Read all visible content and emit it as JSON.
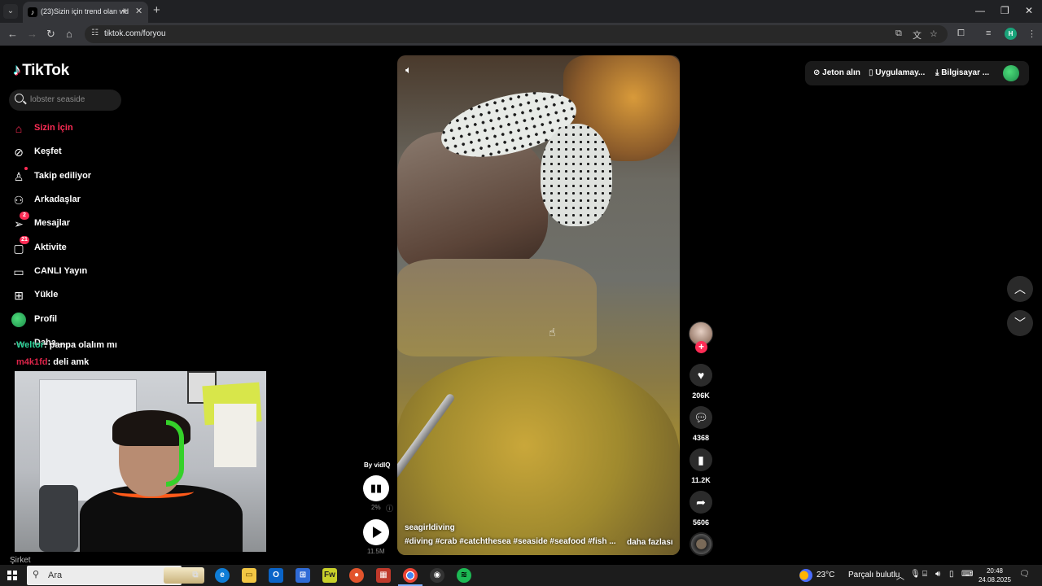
{
  "browser": {
    "tab_title": "(23)Sizin için trend olan vid",
    "url": "tiktok.com/foryou",
    "profile_initial": "H"
  },
  "tiktok": {
    "logo": "TikTok",
    "search_placeholder": "lobster seaside",
    "nav": [
      {
        "label": "Sizin İçin",
        "icon": "home-icon",
        "active": true
      },
      {
        "label": "Keşfet",
        "icon": "compass-icon"
      },
      {
        "label": "Takip ediliyor",
        "icon": "following-icon"
      },
      {
        "label": "Arkadaşlar",
        "icon": "friends-icon"
      },
      {
        "label": "Mesajlar",
        "icon": "inbox-icon",
        "badge": "2"
      },
      {
        "label": "Aktivite",
        "icon": "activity-icon",
        "badge": "21"
      },
      {
        "label": "CANLI Yayın",
        "icon": "live-icon"
      },
      {
        "label": "Yükle",
        "icon": "upload-icon"
      },
      {
        "label": "Profil",
        "icon": "profile-icon"
      },
      {
        "label": "Daha ...",
        "icon": "more-icon"
      }
    ],
    "top_actions": {
      "coins": "Jeton alın",
      "app": "Uygulamay...",
      "desktop": "Bilgisayar ..."
    },
    "video": {
      "author": "seagirldiving",
      "tags": "#diving #crab #catchthesea #seaside #seafood #fish ...",
      "more": "daha fazlası"
    },
    "actions": {
      "likes": "206K",
      "comments": "4368",
      "saves": "11.2K",
      "shares": "5606"
    },
    "vidiq": {
      "label": "By vidIQ",
      "percent": "2%",
      "views": "11.5M"
    }
  },
  "stream": {
    "chat": [
      {
        "user": "Weltor",
        "message": ": panpa olalım mı"
      },
      {
        "user": "m4k1fd",
        "message": ": deli amk"
      }
    ],
    "folder_label": "Şirket"
  },
  "taskbar": {
    "search_placeholder": "Ara",
    "temperature": "23°C",
    "weather": "Parçalı bulutlu",
    "time": "20:48",
    "date": "24.08.2025"
  }
}
